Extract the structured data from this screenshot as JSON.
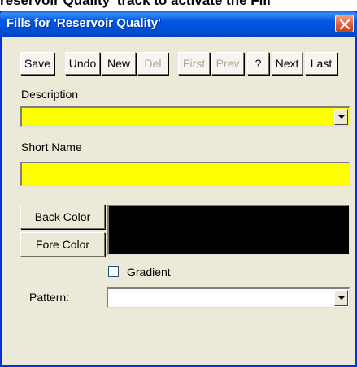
{
  "background": {
    "caption": "reservoir Quality' track to activate the Fill"
  },
  "window": {
    "title": "Fills for 'Reservoir Quality'",
    "close_icon": "close-icon",
    "title_color": "#0058E6"
  },
  "toolbar": {
    "save": "Save",
    "undo": "Undo",
    "new": "New",
    "del": "Del",
    "first": "First",
    "prev": "Prev",
    "help": "?",
    "next": "Next",
    "last": "Last"
  },
  "form": {
    "description_label": "Description",
    "description_value": "",
    "short_name_label": "Short Name",
    "short_name_value": "",
    "back_color_button": "Back Color",
    "fore_color_button": "Fore Color",
    "gradient_label": "Gradient",
    "gradient_checked": false,
    "pattern_label": "Pattern:",
    "pattern_value": "",
    "required_field_color": "#FFFF00",
    "swatch_color": "#000000"
  }
}
